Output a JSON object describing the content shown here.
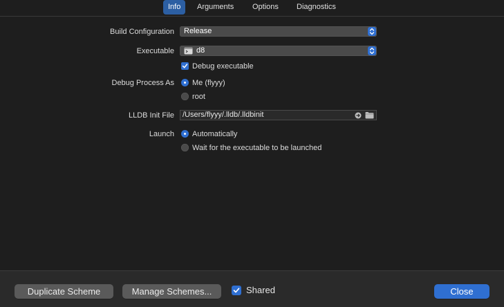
{
  "tabs": [
    "Info",
    "Arguments",
    "Options",
    "Diagnostics"
  ],
  "active_tab": "Info",
  "form": {
    "build_configuration": {
      "label": "Build Configuration",
      "value": "Release"
    },
    "executable": {
      "label": "Executable",
      "value": "d8",
      "icon": "terminal-icon"
    },
    "debug_executable": {
      "label": "Debug executable",
      "checked": true
    },
    "debug_process_as": {
      "label": "Debug Process As",
      "options": [
        "Me (flyyy)",
        "root"
      ],
      "selected": "Me (flyyy)"
    },
    "lldb_init_file": {
      "label": "LLDB Init File",
      "value": "/Users/flyyy/.lldb/.lldbinit"
    },
    "launch": {
      "label": "Launch",
      "options": [
        "Automatically",
        "Wait for the executable to be launched"
      ],
      "selected": "Automatically"
    }
  },
  "footer": {
    "duplicate_scheme": "Duplicate Scheme",
    "manage_schemes": "Manage Schemes...",
    "shared": {
      "label": "Shared",
      "checked": true
    },
    "close": "Close"
  },
  "colors": {
    "accent": "#2f6fd1",
    "background": "#1e1e1e",
    "footer": "#2a2a2a"
  }
}
